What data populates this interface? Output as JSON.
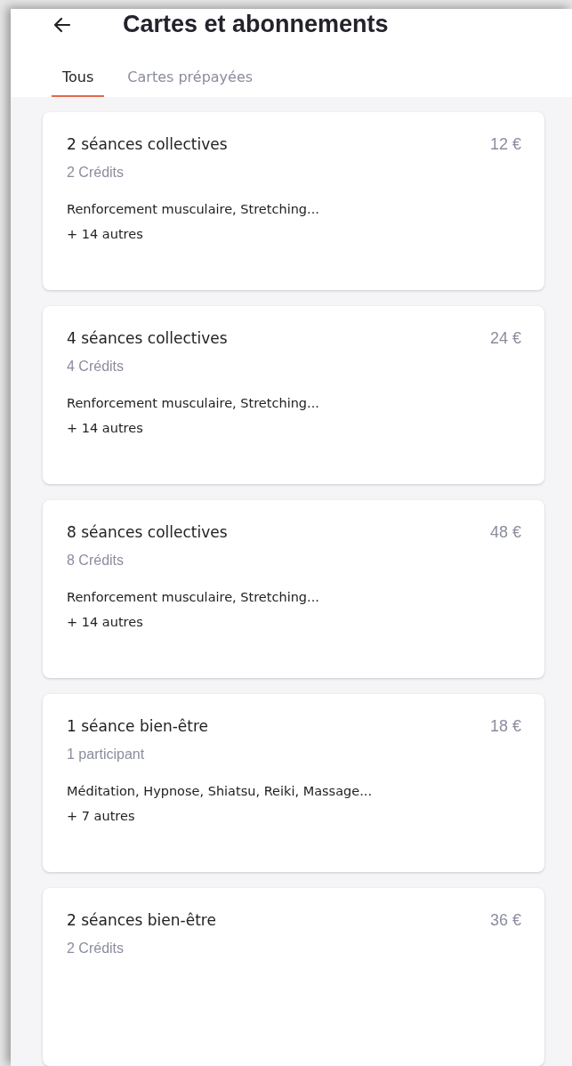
{
  "header": {
    "title": "Cartes et abonnements"
  },
  "tabs": [
    {
      "label": "Tous",
      "selected": true
    },
    {
      "label": "Cartes prépayées",
      "selected": false
    }
  ],
  "cards": [
    {
      "title": "2 séances collectives",
      "price": "12 €",
      "subtitle": "2 Crédits",
      "activities": "Renforcement musculaire, Stretching...",
      "more": "+ 14 autres"
    },
    {
      "title": "4 séances collectives",
      "price": "24 €",
      "subtitle": "4 Crédits",
      "activities": "Renforcement musculaire, Stretching...",
      "more": "+ 14 autres"
    },
    {
      "title": "8 séances collectives",
      "price": "48 €",
      "subtitle": "8 Crédits",
      "activities": "Renforcement musculaire, Stretching...",
      "more": "+ 14 autres"
    },
    {
      "title": "1 séance bien-être",
      "price": "18 €",
      "subtitle": "1 participant",
      "activities": "Méditation, Hypnose, Shiatsu, Reiki, Massage...",
      "more": "+ 7 autres"
    },
    {
      "title": "2 séances bien-être",
      "price": "36 €",
      "subtitle": "2 Crédits"
    }
  ]
}
